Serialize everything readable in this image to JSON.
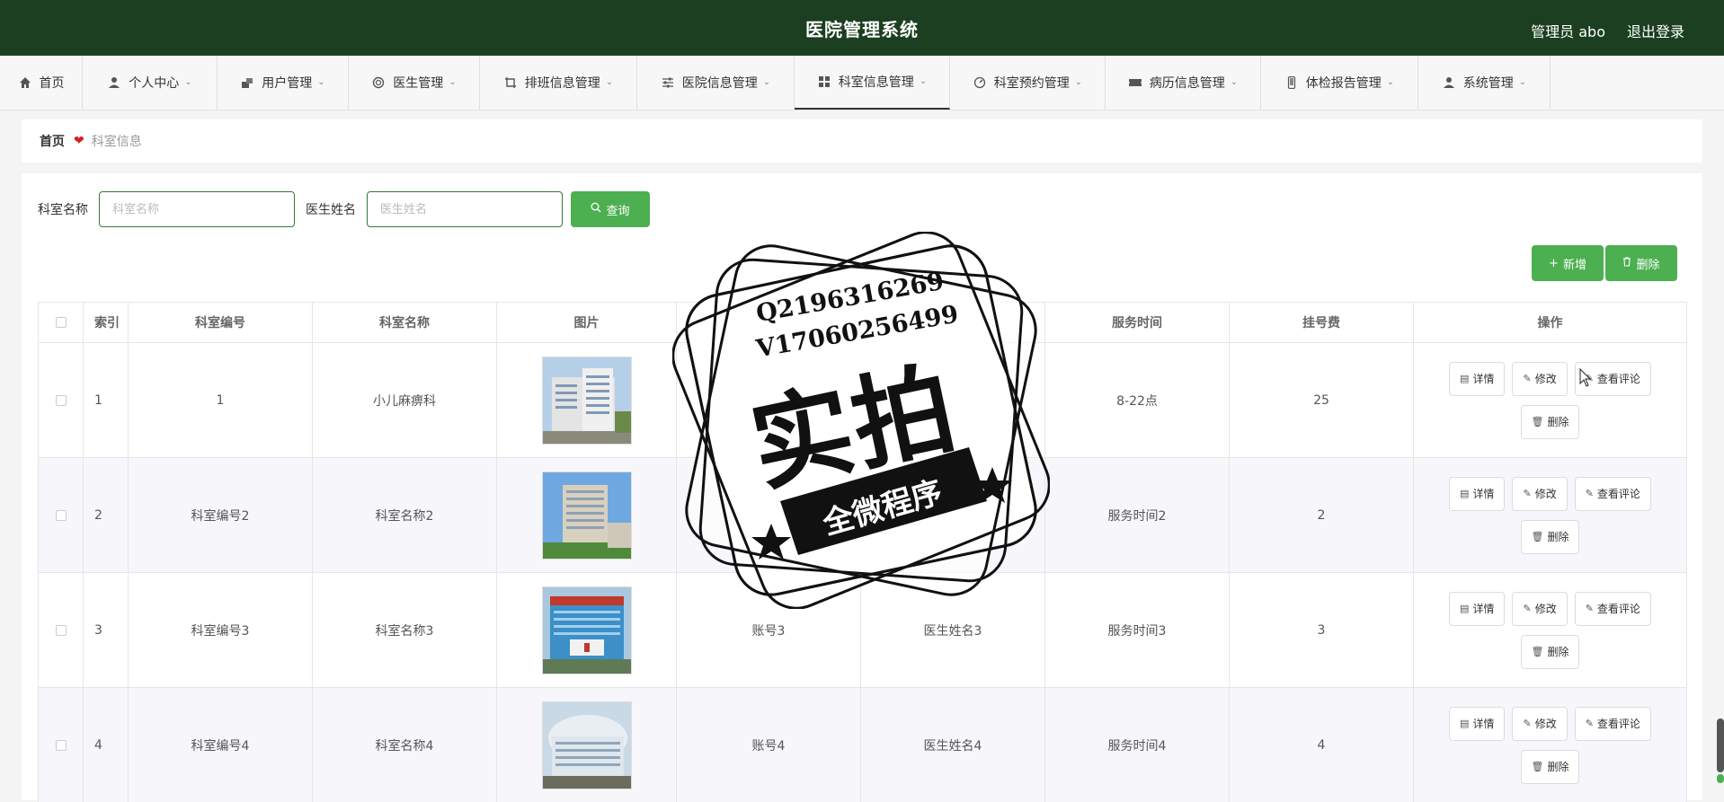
{
  "header": {
    "title": "医院管理系统",
    "user": "管理员 abo",
    "logout": "退出登录"
  },
  "nav": [
    {
      "label": "首页",
      "icon": "home-icon"
    },
    {
      "label": "个人中心",
      "icon": "person-icon"
    },
    {
      "label": "用户管理",
      "icon": "users-icon"
    },
    {
      "label": "医生管理",
      "icon": "doctor-icon"
    },
    {
      "label": "排班信息管理",
      "icon": "crop-icon"
    },
    {
      "label": "医院信息管理",
      "icon": "sliders-icon"
    },
    {
      "label": "科室信息管理",
      "icon": "grid-icon"
    },
    {
      "label": "科室预约管理",
      "icon": "gauge-icon"
    },
    {
      "label": "病历信息管理",
      "icon": "ticket-icon"
    },
    {
      "label": "体检报告管理",
      "icon": "phone-icon"
    },
    {
      "label": "系统管理",
      "icon": "person-icon"
    }
  ],
  "breadcrumb": {
    "home": "首页",
    "current": "科室信息"
  },
  "search": {
    "dept_label": "科室名称",
    "dept_placeholder": "科室名称",
    "doctor_label": "医生姓名",
    "doctor_placeholder": "医生姓名",
    "button": "查询"
  },
  "actions": {
    "add": "新增",
    "delete": "删除"
  },
  "table": {
    "headers": [
      "索引",
      "科室编号",
      "科室名称",
      "图片",
      "账号",
      "医生姓名",
      "服务时间",
      "挂号费",
      "操作"
    ],
    "rows": [
      {
        "index": "1",
        "code": "1",
        "name": "小儿麻痹科",
        "account": "",
        "doctor": "",
        "time": "8-22点",
        "fee": "25"
      },
      {
        "index": "2",
        "code": "科室编号2",
        "name": "科室名称2",
        "account": "账号2",
        "doctor": "医生姓名2",
        "time": "服务时间2",
        "fee": "2"
      },
      {
        "index": "3",
        "code": "科室编号3",
        "name": "科室名称3",
        "account": "账号3",
        "doctor": "医生姓名3",
        "time": "服务时间3",
        "fee": "3"
      },
      {
        "index": "4",
        "code": "科室编号4",
        "name": "科室名称4",
        "account": "账号4",
        "doctor": "医生姓名4",
        "time": "服务时间4",
        "fee": "4"
      }
    ],
    "ops": {
      "detail": "详情",
      "edit": "修改",
      "comments": "查看评论",
      "delete": "删除"
    }
  },
  "watermark": {
    "qq": "Q2196316269",
    "vx": "V17060256499",
    "main": "实拍",
    "sub": "全微程序"
  },
  "colors": {
    "header_bg": "#1b3f20",
    "accent": "#4caf50",
    "heart": "#d62020"
  }
}
